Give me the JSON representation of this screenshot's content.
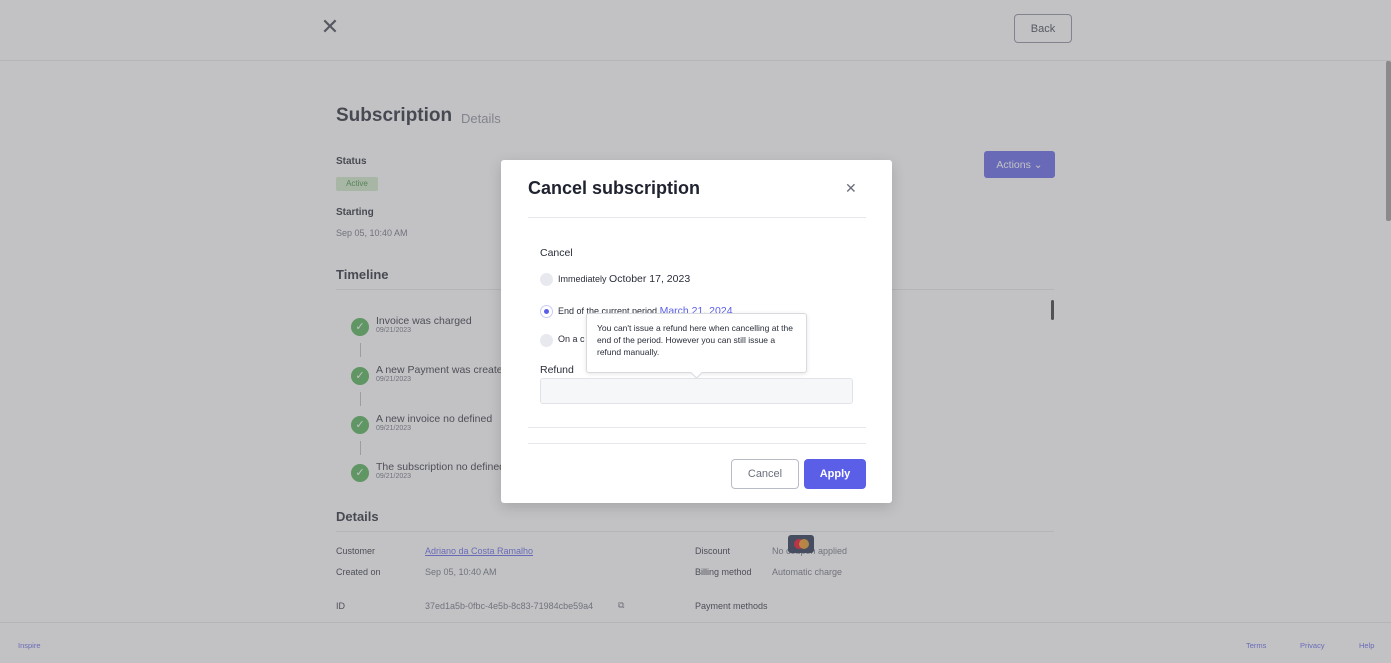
{
  "topbar": {
    "close_icon": "close-icon",
    "back_label": "Back"
  },
  "page": {
    "title": "Subscription",
    "subtitle": "Details",
    "actions_label": "Actions ⌄",
    "status_label": "Status",
    "status_value": "Active",
    "starting_label": "Starting",
    "starting_value": "Sep 05, 10:40 AM",
    "timeline_title": "Timeline",
    "timeline": [
      {
        "text": "Invoice was charged",
        "date": "09/21/2023"
      },
      {
        "text": "A new Payment was created",
        "date": "09/21/2023"
      },
      {
        "text": "A new invoice no defined",
        "date": "09/21/2023"
      },
      {
        "text": "The subscription no defined",
        "date": "09/21/2023"
      }
    ],
    "details_title": "Details",
    "details": {
      "customer_label": "Customer",
      "customer_value": "Adriano da Costa Ramalho",
      "created_label": "Created on",
      "created_value": "Sep 05, 10:40 AM",
      "id_label": "ID",
      "id_value": "37ed1a5b-0fbc-4e5b-8c83-71984cbe59a4",
      "discount_label": "Discount",
      "discount_value": "No coupon applied",
      "billing_label": "Billing method",
      "billing_value": "Automatic charge",
      "payment_label": "Payment methods",
      "payment_icon": "mastercard-icon"
    }
  },
  "footer": {
    "brand": "Inspire",
    "terms": "Terms",
    "privacy": "Privacy",
    "help": "Help"
  },
  "modal": {
    "title": "Cancel subscription",
    "close_icon": "close-icon",
    "cancel_section": "Cancel",
    "options": [
      {
        "label": "Immediately",
        "date": "October 17, 2023",
        "selected": false
      },
      {
        "label": "End of the current period",
        "date": "March 21, 2024",
        "selected": true
      },
      {
        "label": "On a c",
        "date": "",
        "selected": false
      }
    ],
    "tooltip": "You can't issue a refund here when cancelling at the end of the period. However you can still issue a refund manually.",
    "refund_label": "Refund",
    "refund_value": "",
    "cancel_button": "Cancel",
    "apply_button": "Apply"
  },
  "colors": {
    "accent": "#5b5fe8",
    "success": "#4caf50"
  }
}
